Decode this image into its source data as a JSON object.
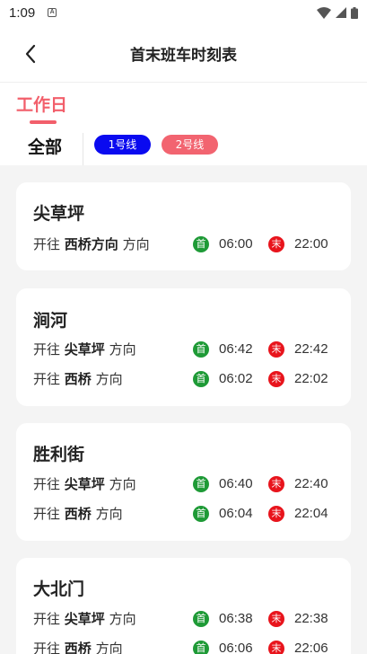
{
  "status_bar": {
    "time": "1:09",
    "app_icon": "A"
  },
  "header": {
    "title": "首末班车时刻表",
    "back_icon": "chevron-left-icon"
  },
  "tabs": {
    "workday": "工作日"
  },
  "filters": {
    "all": "全部",
    "lines": [
      "1号线",
      "2号线"
    ]
  },
  "labels": {
    "toward": "开往",
    "direction": "方向",
    "first": "首",
    "last": "末"
  },
  "colors": {
    "accent": "#f25f6b",
    "line1": "#0a0af0",
    "line2": "#f26470",
    "first_badge": "#1e9a36",
    "last_badge": "#e8141c"
  },
  "stations": [
    {
      "name": "尖草坪",
      "directions": [
        {
          "target": "西桥方向",
          "first": "06:00",
          "last": "22:00"
        }
      ]
    },
    {
      "name": "涧河",
      "directions": [
        {
          "target": "尖草坪",
          "first": "06:42",
          "last": "22:42"
        },
        {
          "target": "西桥",
          "first": "06:02",
          "last": "22:02"
        }
      ]
    },
    {
      "name": "胜利街",
      "directions": [
        {
          "target": "尖草坪",
          "first": "06:40",
          "last": "22:40"
        },
        {
          "target": "西桥",
          "first": "06:04",
          "last": "22:04"
        }
      ]
    },
    {
      "name": "大北门",
      "directions": [
        {
          "target": "尖草坪",
          "first": "06:38",
          "last": "22:38"
        },
        {
          "target": "西桥",
          "first": "06:06",
          "last": "22:06"
        }
      ]
    }
  ]
}
